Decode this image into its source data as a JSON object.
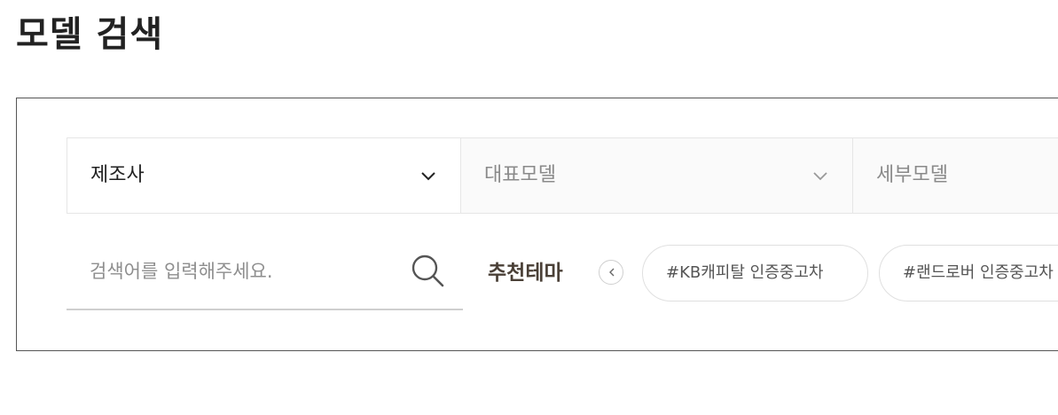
{
  "page": {
    "title": "모델 검색"
  },
  "filters": {
    "manufacturer": {
      "label": "제조사",
      "icon": "chevron-down-icon"
    },
    "model": {
      "label": "대표모델",
      "icon": "chevron-down-icon"
    },
    "detail_model": {
      "label": "세부모델"
    }
  },
  "search": {
    "placeholder": "검색어를 입력해주세요.",
    "value": "",
    "icon": "search-icon"
  },
  "themes": {
    "label": "추천테마",
    "prev_icon": "chevron-left-icon",
    "chips": [
      {
        "label": "#KB캐피탈 인증중고차"
      },
      {
        "label": "#랜드로버 인증중고차"
      }
    ]
  },
  "colors": {
    "text": "#222222",
    "muted": "#8a8a8a",
    "theme_label": "#4a4037",
    "panel_border": "#555555"
  }
}
